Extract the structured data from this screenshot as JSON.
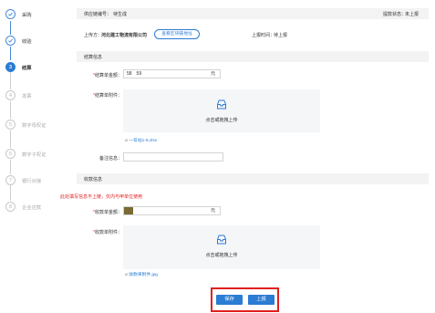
{
  "steps": [
    {
      "num": "1",
      "label": "采购",
      "state": "done"
    },
    {
      "num": "2",
      "label": "收验",
      "state": "done"
    },
    {
      "num": "3",
      "label": "结算",
      "state": "active"
    },
    {
      "num": "4",
      "label": "发票",
      "state": "pending"
    },
    {
      "num": "5",
      "label": "数字母权证",
      "state": "pending"
    },
    {
      "num": "6",
      "label": "数字子权证",
      "state": "pending"
    },
    {
      "num": "7",
      "label": "银行对接",
      "state": "pending"
    },
    {
      "num": "8",
      "label": "企业还款",
      "state": "pending"
    }
  ],
  "header": {
    "supply_number_label": "供应链编号：",
    "supply_number_value": "待生成",
    "status_label": "提款状态：",
    "status_value": "未上报",
    "uploader_label": "上传方：",
    "uploader_value": "河北建工物流有限公司",
    "blockchain_button": "查看区块链地址",
    "upload_time_label": "上报时间：",
    "upload_time_value": "待上报"
  },
  "settlement": {
    "section_title": "结算信息",
    "amount_label": "结算单金额：",
    "amount_value": "58　59",
    "amount_unit": "元",
    "attachment_label": "结算单附件：",
    "upload_text": "点击或拖拽上传",
    "attached_file": "一号站1-6.xlsx",
    "remark_label": "备注信息："
  },
  "receipt": {
    "section_title": "收款信息",
    "warning": "此处填写信息不上链，仅内与甲单位使用",
    "amount_label": "收款单金额：",
    "amount_unit": "元",
    "attachment_label": "收款单附件：",
    "upload_text": "点击或拖拽上传",
    "attached_file": "收款单附件.jpg"
  },
  "actions": {
    "save": "保存",
    "upload": "上报"
  },
  "colors": {
    "primary": "#2b7cd3",
    "required": "#e23a3a",
    "highlight_box": "#e02020",
    "amount_swatch": "#7a6a33"
  }
}
